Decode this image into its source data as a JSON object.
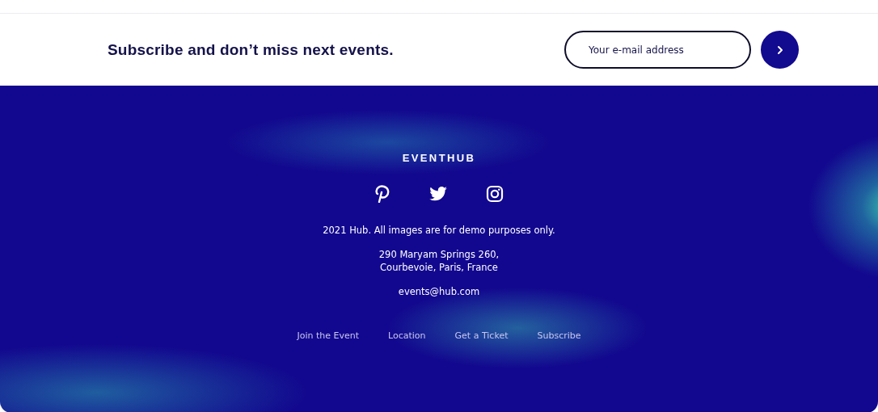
{
  "subscribe": {
    "heading": "Subscribe and don’t miss next events.",
    "email_field": {
      "placeholder": "Your e-mail address"
    }
  },
  "footer": {
    "brand": "EVENTHUB",
    "copyright": "2021 Hub. All images are for demo purposes only.",
    "address": [
      "290 Maryam Springs 260,",
      "Courbevoie, Paris, France"
    ],
    "email": "events@hub.com",
    "links": [
      "Join the Event",
      "Location",
      "Get a Ticket",
      "Subscribe"
    ]
  }
}
